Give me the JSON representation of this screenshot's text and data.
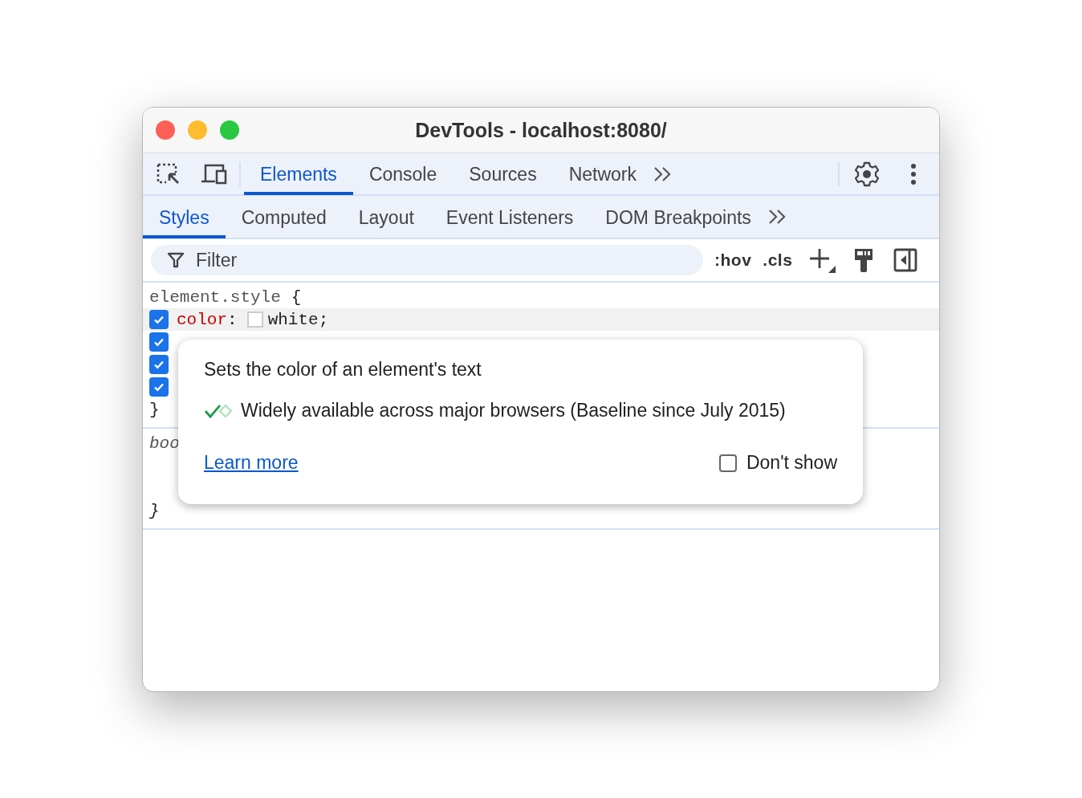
{
  "window": {
    "title": "DevTools - localhost:8080/"
  },
  "main_tabs": [
    {
      "label": "Elements",
      "selected": true
    },
    {
      "label": "Console",
      "selected": false
    },
    {
      "label": "Sources",
      "selected": false
    },
    {
      "label": "Network",
      "selected": false
    }
  ],
  "sub_tabs": [
    {
      "label": "Styles",
      "selected": true
    },
    {
      "label": "Computed",
      "selected": false
    },
    {
      "label": "Layout",
      "selected": false
    },
    {
      "label": "Event Listeners",
      "selected": false
    },
    {
      "label": "DOM Breakpoints",
      "selected": false
    }
  ],
  "filter": {
    "placeholder": "Filter"
  },
  "toolbar_buttons": [
    ":hov",
    ".cls"
  ],
  "rules": [
    {
      "selector": "element.style",
      "kind": "inline",
      "open": "{",
      "close": "}",
      "declarations": [
        {
          "property": "color",
          "colon": ":",
          "value": "white;",
          "checked": true
        },
        {
          "checked": true
        },
        {
          "checked": true
        },
        {
          "checked": true
        }
      ]
    },
    {
      "selector": "boo",
      "kind": "user-agent",
      "close": "}"
    }
  ],
  "popup": {
    "description": "Sets the color of an element's text",
    "baseline": "Widely available across major browsers (Baseline since July 2015)",
    "link": "Learn more",
    "dont_show": {
      "label": "Don't show",
      "checked": false
    }
  }
}
